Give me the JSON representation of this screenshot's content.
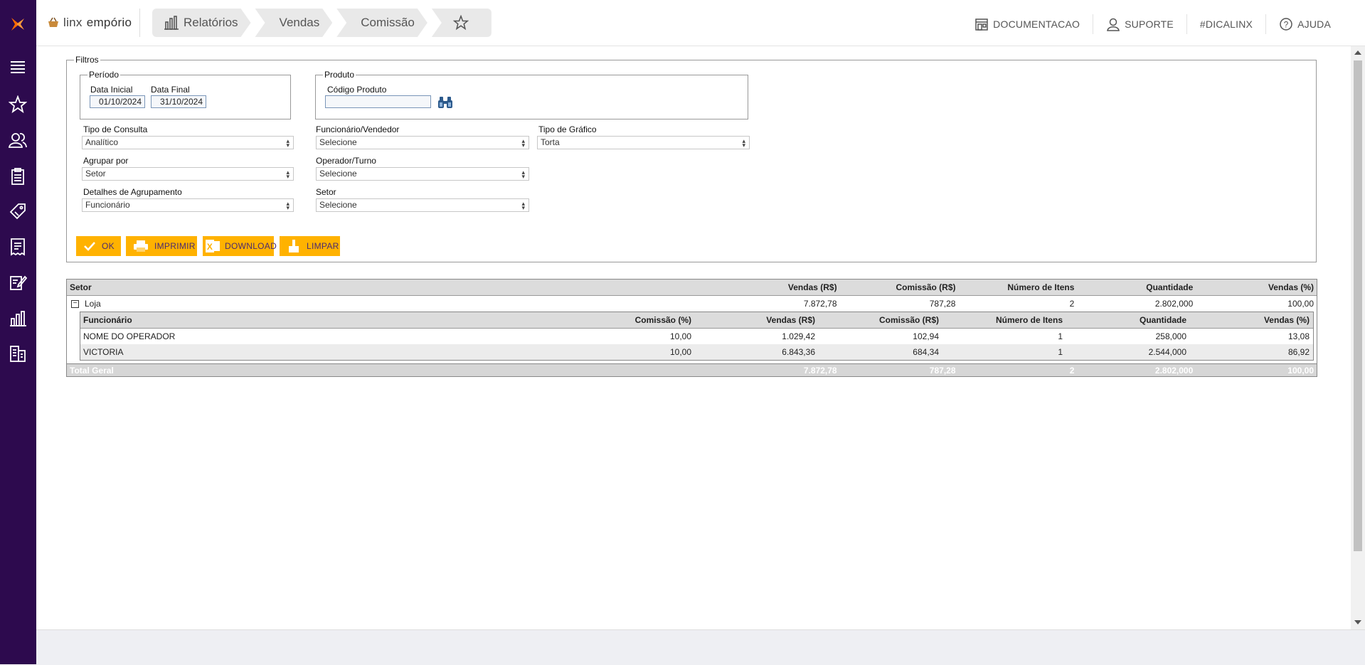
{
  "brand": {
    "part1": "linx",
    "part2": "empório"
  },
  "breadcrumbs": [
    {
      "label": "Relatórios",
      "icon": "bar-chart-icon"
    },
    {
      "label": "Vendas"
    },
    {
      "label": "Comissão"
    }
  ],
  "topbar": {
    "documentacao": "DOCUMENTACAO",
    "suporte": "SUPORTE",
    "dicalinx": "#DICALINX",
    "ajuda": "AJUDA"
  },
  "sidebar_icons": [
    "menu-icon",
    "star-icon",
    "users-icon",
    "clipboard-icon",
    "tag-icon",
    "receipt-icon",
    "edit-document-icon",
    "bar-chart-icon",
    "buildings-icon"
  ],
  "filters": {
    "legend": "Filtros",
    "periodo": {
      "legend": "Período",
      "data_inicial_label": "Data Inicial",
      "data_inicial": "01/10/2024",
      "data_final_label": "Data Final",
      "data_final": "31/10/2024"
    },
    "produto": {
      "legend": "Produto",
      "codigo_label": "Código Produto",
      "codigo_value": ""
    },
    "tipo_consulta": {
      "label": "Tipo de Consulta",
      "value": "Analítico"
    },
    "agrupar_por": {
      "label": "Agrupar por",
      "value": "Setor"
    },
    "detalhes_agrupamento": {
      "label": "Detalhes de Agrupamento",
      "value": "Funcionário"
    },
    "funcionario": {
      "label": "Funcionário/Vendedor",
      "value": "Selecione"
    },
    "operador": {
      "label": "Operador/Turno",
      "value": "Selecione"
    },
    "setor": {
      "label": "Setor",
      "value": "Selecione"
    },
    "tipo_grafico": {
      "label": "Tipo de Gráfico",
      "value": "Torta"
    }
  },
  "buttons": {
    "ok": "OK",
    "imprimir": "IMPRIMIR",
    "download": "DOWNLOAD",
    "limpar": "LIMPAR"
  },
  "grid": {
    "headers": [
      "Setor",
      "Vendas (R$)",
      "Comissão (R$)",
      "Número de Itens",
      "Quantidade",
      "Vendas (%)"
    ],
    "group": {
      "setor": "Loja",
      "vendas": "7.872,78",
      "comissao": "787,28",
      "itens": "2",
      "quantidade": "2.802,000",
      "vendas_pct": "100,00"
    },
    "inner_headers": [
      "Funcionário",
      "Comissão (%)",
      "Vendas (R$)",
      "Comissão (R$)",
      "Número de Itens",
      "Quantidade",
      "Vendas (%)"
    ],
    "rows": [
      {
        "funcionario": "NOME DO OPERADOR",
        "comissao_pct": "10,00",
        "vendas": "1.029,42",
        "comissao": "102,94",
        "itens": "1",
        "quantidade": "258,000",
        "vendas_pct": "13,08"
      },
      {
        "funcionario": "VICTORIA",
        "comissao_pct": "10,00",
        "vendas": "6.843,36",
        "comissao": "684,34",
        "itens": "1",
        "quantidade": "2.544,000",
        "vendas_pct": "86,92"
      }
    ],
    "total": {
      "label": "Total Geral",
      "vendas": "7.872,78",
      "comissao": "787,28",
      "itens": "2",
      "quantidade": "2.802,000",
      "vendas_pct": "100,00"
    }
  },
  "colors": {
    "sidebar": "#2d0a4e",
    "accent": "#ffb200",
    "logo_orange": "#ff6a00"
  }
}
